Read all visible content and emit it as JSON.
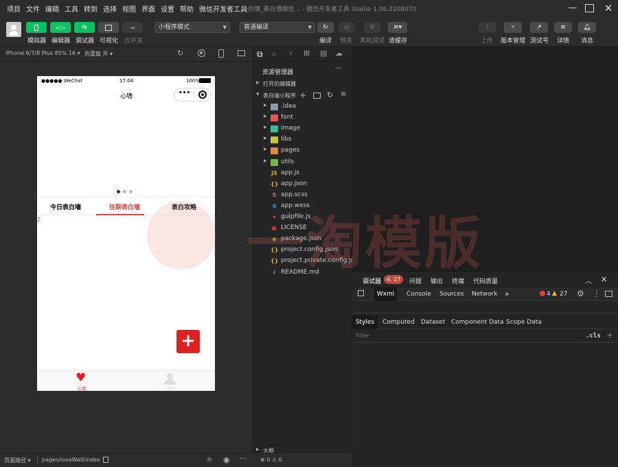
{
  "menubar": {
    "items": [
      "项目",
      "文件",
      "编辑",
      "工具",
      "转到",
      "选择",
      "视图",
      "界面",
      "设置",
      "帮助",
      "微信开发者工具"
    ],
    "window_title": "表白墙_表白墙微信...  - 微信开发者工具 Stable 1.06.2209070"
  },
  "toolbar": {
    "simulator_label": "模拟器",
    "editor_label": "编辑器",
    "debugger_label": "调试器",
    "visual_label": "可视化",
    "cloud_label": "云开发",
    "mode_select": "小程序模式",
    "compile_select": "普通编译",
    "compile_label": "编译",
    "preview_label": "预览",
    "device_debug_label": "真机调试",
    "clear_cache_label": "清缓存",
    "upload_label": "上传",
    "version_label": "版本管理",
    "test_label": "测试号",
    "details_label": "详情",
    "messages_label": "消息",
    "accent_green": "#07c160"
  },
  "simulator": {
    "device": "iPhone 6/7/8 Plus 85% 16 ▾",
    "hot_reload": "热重载 开 ▾",
    "status": {
      "carrier": "●●●●● WeChat",
      "time": "17:04",
      "battery": "100%"
    },
    "nav_title": "心墙",
    "nav_capsule_more": "•••",
    "tabs": [
      "今日表白墙",
      "往期表白墙",
      "表白攻略"
    ],
    "active_tab_color": "#e64340",
    "list_index": "2",
    "fab_symbol": "+",
    "tabbar": [
      {
        "label": "心墙"
      },
      {
        "label": "我的"
      }
    ]
  },
  "explorer": {
    "title": "资源管理器",
    "more": "···",
    "open_editors": "打开的编辑器",
    "project": "表白墙小程序",
    "outline": "大纲",
    "errors_summary": "⊗ 0 ⚠ 0",
    "files": [
      {
        "name": ".idea",
        "icon": "folder-icon",
        "color": "#8a9aaa",
        "folder": true
      },
      {
        "name": "font",
        "icon": "font-folder-icon",
        "color": "#e05a5a",
        "folder": true
      },
      {
        "name": "image",
        "icon": "image-folder-icon",
        "color": "#3cb89a",
        "folder": true
      },
      {
        "name": "libs",
        "icon": "libs-folder-icon",
        "color": "#c8c040",
        "folder": true
      },
      {
        "name": "pages",
        "icon": "pages-folder-icon",
        "color": "#e08a50",
        "folder": true
      },
      {
        "name": "utils",
        "icon": "utils-folder-icon",
        "color": "#7ab34c",
        "folder": true
      },
      {
        "name": "app.js",
        "icon": "js-file-icon",
        "color": "#d6b400",
        "glyph": "JS"
      },
      {
        "name": "app.json",
        "icon": "json-file-icon",
        "color": "#d6b400",
        "glyph": "{}"
      },
      {
        "name": "app.scss",
        "icon": "scss-file-icon",
        "color": "#cc6699",
        "glyph": "S"
      },
      {
        "name": "app.wxss",
        "icon": "wxss-file-icon",
        "color": "#4a9bdc",
        "glyph": "≡"
      },
      {
        "name": "gulpfile.js",
        "icon": "gulp-file-icon",
        "color": "#e0443a",
        "glyph": "✦"
      },
      {
        "name": "LICENSE",
        "icon": "license-file-icon",
        "color": "#e0443a",
        "glyph": "▣"
      },
      {
        "name": "package.json",
        "icon": "npm-file-icon",
        "color": "#7ab34c",
        "glyph": "◉"
      },
      {
        "name": "project.config.json",
        "icon": "json-file-icon",
        "color": "#d6b400",
        "glyph": "{}"
      },
      {
        "name": "project.private.config.js...",
        "icon": "json-file-icon",
        "color": "#d6b400",
        "glyph": "{}"
      },
      {
        "name": "README.md",
        "icon": "info-file-icon",
        "color": "#4a9bdc",
        "glyph": "i"
      }
    ]
  },
  "devtools": {
    "tabs": [
      "调试器",
      "问题",
      "输出",
      "终端",
      "代码质量"
    ],
    "badge": "4, 27",
    "subtabs": [
      "Wxml",
      "Console",
      "Sources",
      "Network"
    ],
    "more_tabs": "»",
    "errors_count": "4",
    "warnings_count": "27",
    "style_tabs": [
      "Styles",
      "Computed",
      "Dataset",
      "Component Data",
      "Scope Data"
    ],
    "filter_placeholder": "Filter",
    "cls_label": ".cls",
    "add_rule": "+"
  },
  "statusbar": {
    "path_label": "页面路径 ▾",
    "path": "pages/loveWall/index"
  },
  "watermark": "一淘模版"
}
